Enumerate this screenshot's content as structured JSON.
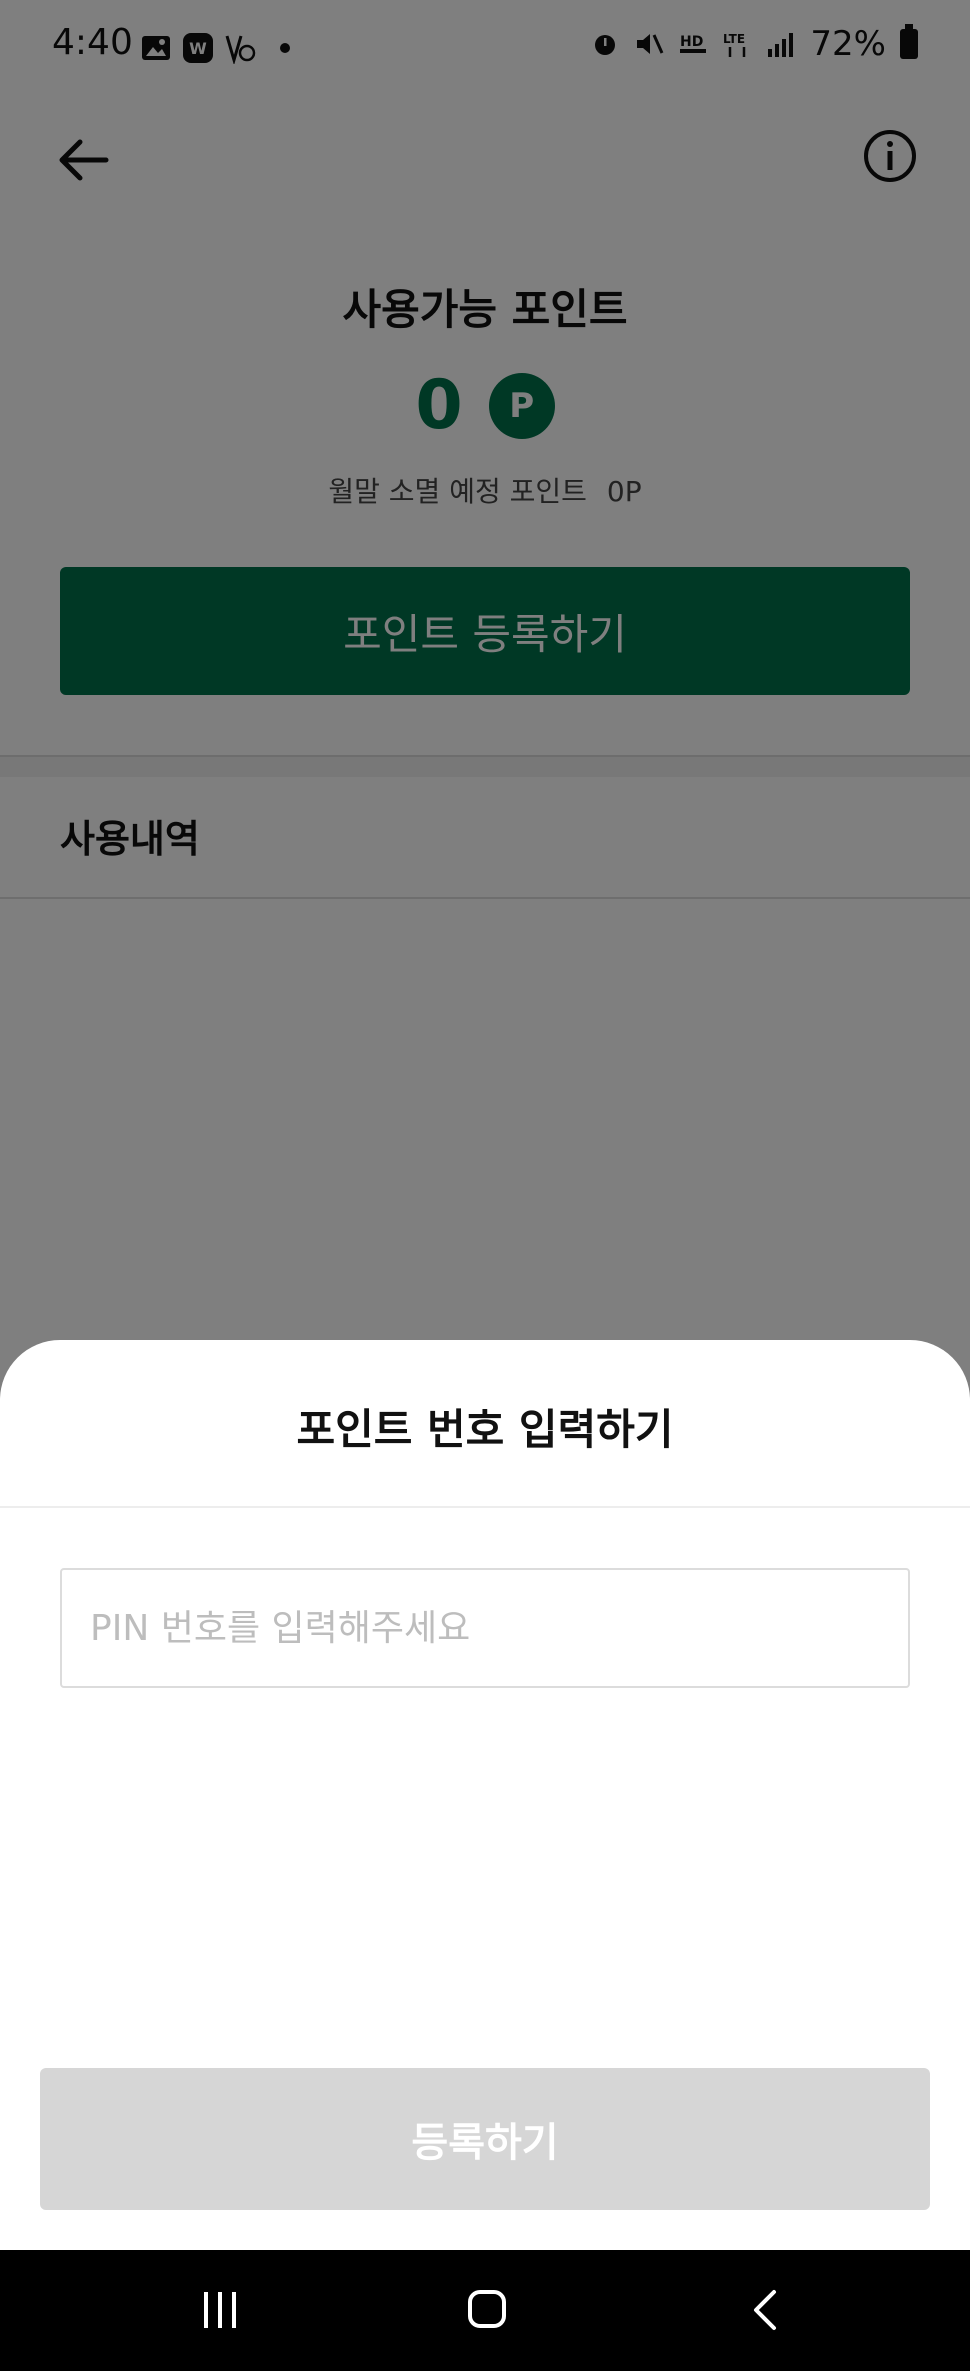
{
  "status_bar": {
    "time": "4:40",
    "left_icons": [
      "image-icon",
      "w-app-icon",
      "voice-mail-icon"
    ],
    "right_icons": [
      "alarm-icon",
      "mute-icon",
      "hd-voice-icon",
      "lte-icon",
      "signal-icon"
    ],
    "battery": "72%"
  },
  "header": {
    "back_icon": "arrow-left-icon",
    "info_icon": "info-icon"
  },
  "points": {
    "title": "사용가능 포인트",
    "value": "0",
    "badge": "P",
    "expire_label": "월말 소멸 예정 포인트",
    "expire_value": "0P",
    "register_button": "포인트 등록하기"
  },
  "history": {
    "title": "사용내역"
  },
  "sheet": {
    "title": "포인트 번호 입력하기",
    "input_placeholder": "PIN 번호를 입력해주세요",
    "input_value": "",
    "submit_button": "등록하기"
  },
  "colors": {
    "brand_green": "#00704a",
    "disabled_gray": "#d6d6d6",
    "overlay": "rgba(0,0,0,0.5)"
  }
}
